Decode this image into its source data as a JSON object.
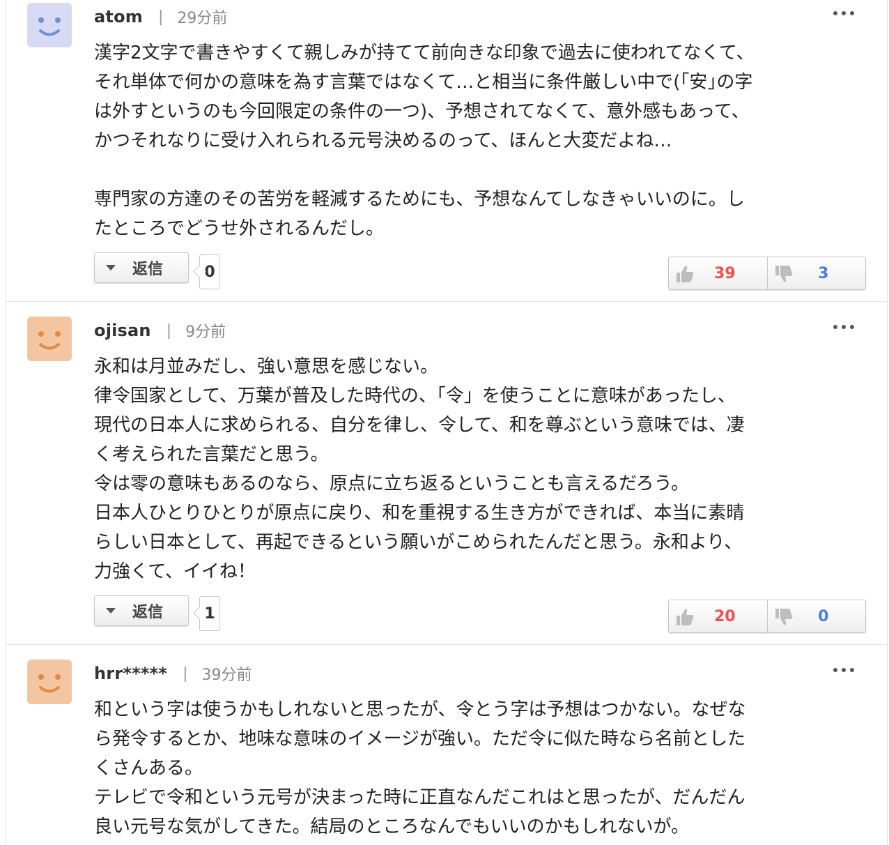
{
  "colors": {
    "like_count": "#f0504f",
    "dislike_count": "#4d7fd3",
    "avatar_blue_bg": "#d7daf5",
    "avatar_blue_face": "#6f8fd8",
    "avatar_orange_bg": "#f3c6a1",
    "avatar_orange_face": "#e08a45"
  },
  "comments": [
    {
      "avatar_icon": "smiley-avatar-icon",
      "author": "atom",
      "separator": "|",
      "time": "29分前",
      "body": "漢字2文字で書きやすくて親しみが持てて前向きな印象で過去に使われてなくて、\nそれ単体で何かの意味を為す言葉ではなくて…と相当に条件厳しい中で(｢安｣の字\nは外すというのも今回限定の条件の一つ)、予想されてなくて、意外感もあって、\nかつそれなりに受け入れられる元号決めるのって、ほんと大変だよね…\n\n専門家の方達のその苦労を軽減するためにも、予想なんてしなきゃいいのに。し\nたところでどうせ外されるんだし。",
      "reply_label": "返信",
      "reply_count": "0",
      "likes": "39",
      "dislikes": "3"
    },
    {
      "avatar_icon": "smiley-avatar-icon",
      "author": "ojisan",
      "separator": "|",
      "time": "9分前",
      "body": "永和は月並みだし、強い意思を感じない。\n律令国家として、万葉が普及した時代の、「令」を使うことに意味があったし、\n現代の日本人に求められる、自分を律し、令して、和を尊ぶという意味では、凄\nく考えられた言葉だと思う。\n令は零の意味もあるのなら、原点に立ち返るということも言えるだろう。\n日本人ひとりひとりが原点に戻り、和を重視する生き方ができれば、本当に素晴\nらしい日本として、再起できるという願いがこめられたんだと思う。永和より、\n力強くて、イイね！",
      "reply_label": "返信",
      "reply_count": "1",
      "likes": "20",
      "dislikes": "0"
    },
    {
      "avatar_icon": "smiley-avatar-icon",
      "author": "hrr*****",
      "separator": "|",
      "time": "39分前",
      "body": "和という字は使うかもしれないと思ったが、令とう字は予想はつかない。なぜな\nら発令するとか、地味な意味のイメージが強い。ただ令に似た時なら名前とした\nくさんある。\nテレビで令和という元号が決まった時に正直なんだこれはと思ったが、だんだん\n良い元号な気がしてきた。結局のところなんでもいいのかもしれないが。"
    }
  ]
}
